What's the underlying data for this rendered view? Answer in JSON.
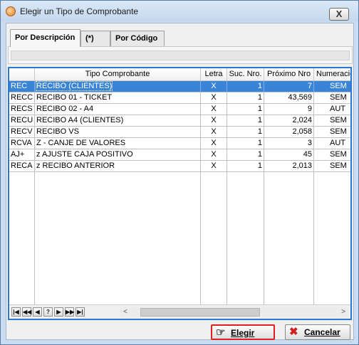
{
  "window": {
    "title": "Elegir un Tipo de Comprobante",
    "close_glyph": "X"
  },
  "tabs": [
    {
      "label": "Por Descripción",
      "active": true
    },
    {
      "label": "(*)",
      "active": false
    },
    {
      "label": "Por Código",
      "active": false
    }
  ],
  "grid": {
    "columns": [
      "",
      "Tipo Comprobante",
      "Letra",
      "Suc. Nro.",
      "Próximo Nro",
      "Numeración"
    ],
    "rows": [
      {
        "code": "REC",
        "tipo": "RECIBO (CLIENTES)",
        "letra": "X",
        "suc": "1",
        "proximo": "7",
        "numeracion": "SEM",
        "selected": true
      },
      {
        "code": "RECC",
        "tipo": "RECIBO 01 - TICKET",
        "letra": "X",
        "suc": "1",
        "proximo": "43,569",
        "numeracion": "SEM",
        "selected": false
      },
      {
        "code": "RECS",
        "tipo": "RECIBO 02 - A4",
        "letra": "X",
        "suc": "1",
        "proximo": "9",
        "numeracion": "AUT",
        "selected": false
      },
      {
        "code": "RECU",
        "tipo": "RECIBO A4 (CLIENTES)",
        "letra": "X",
        "suc": "1",
        "proximo": "2,024",
        "numeracion": "SEM",
        "selected": false
      },
      {
        "code": "RECV",
        "tipo": "RECIBO VS",
        "letra": "X",
        "suc": "1",
        "proximo": "2,058",
        "numeracion": "SEM",
        "selected": false
      },
      {
        "code": "RCVA",
        "tipo": "Z - CANJE DE VALORES",
        "letra": "X",
        "suc": "1",
        "proximo": "3",
        "numeracion": "AUT",
        "selected": false
      },
      {
        "code": "AJ+",
        "tipo": "z AJUSTE CAJA POSITIVO",
        "letra": "X",
        "suc": "1",
        "proximo": "45",
        "numeracion": "SEM",
        "selected": false
      },
      {
        "code": "RECA",
        "tipo": "z RECIBO ANTERIOR",
        "letra": "X",
        "suc": "1",
        "proximo": "2,013",
        "numeracion": "SEM",
        "selected": false
      }
    ]
  },
  "navigator": {
    "buttons": [
      {
        "name": "nav-first-button",
        "glyph": "|◀"
      },
      {
        "name": "nav-prev-page-button",
        "glyph": "◀◀"
      },
      {
        "name": "nav-prev-button",
        "glyph": "◀"
      },
      {
        "name": "nav-search-button",
        "glyph": "?"
      },
      {
        "name": "nav-next-button",
        "glyph": "▶"
      },
      {
        "name": "nav-next-page-button",
        "glyph": "▶▶"
      },
      {
        "name": "nav-last-button",
        "glyph": "▶|"
      }
    ],
    "scroll_left": "<",
    "scroll_right": ">"
  },
  "buttons": {
    "elegir": {
      "label": "Elegir",
      "icon": "pointing-hand-icon"
    },
    "cancelar": {
      "label": "Cancelar",
      "icon": "red-x-icon"
    }
  },
  "colors": {
    "selection": "#3a84d8",
    "grid_border": "#2a78d6",
    "focus_outline": "#e02020",
    "cancel_icon": "#d2201c"
  }
}
